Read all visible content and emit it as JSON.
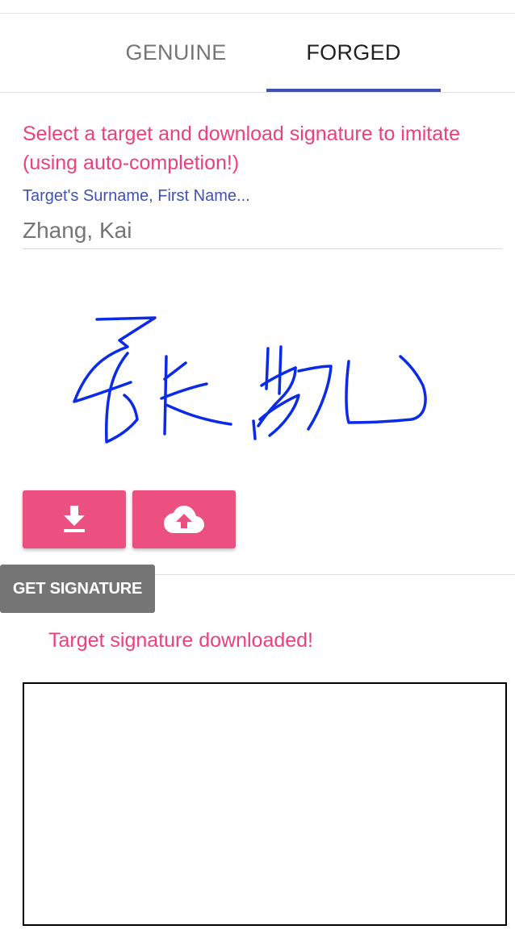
{
  "tabs": [
    {
      "label": "GENUINE",
      "active": false
    },
    {
      "label": "FORGED",
      "active": true
    }
  ],
  "colors": {
    "accent_pink": "#ec407a",
    "button_pink": "#ec5080",
    "indigo": "#3f51b5",
    "signature_ink": "#0a2be8",
    "gray_button": "#757575"
  },
  "forged": {
    "instruction": "Select a target and download signature to imitate (using auto-completion!)",
    "target_field": {
      "label": "Target's Surname, First Name...",
      "value": "Zhang, Kai"
    },
    "buttons": {
      "download_icon": "download-icon",
      "upload_icon": "cloud-upload-icon"
    },
    "get_signature_label": "GET SIGNATURE",
    "status": "Target signature downloaded!"
  }
}
